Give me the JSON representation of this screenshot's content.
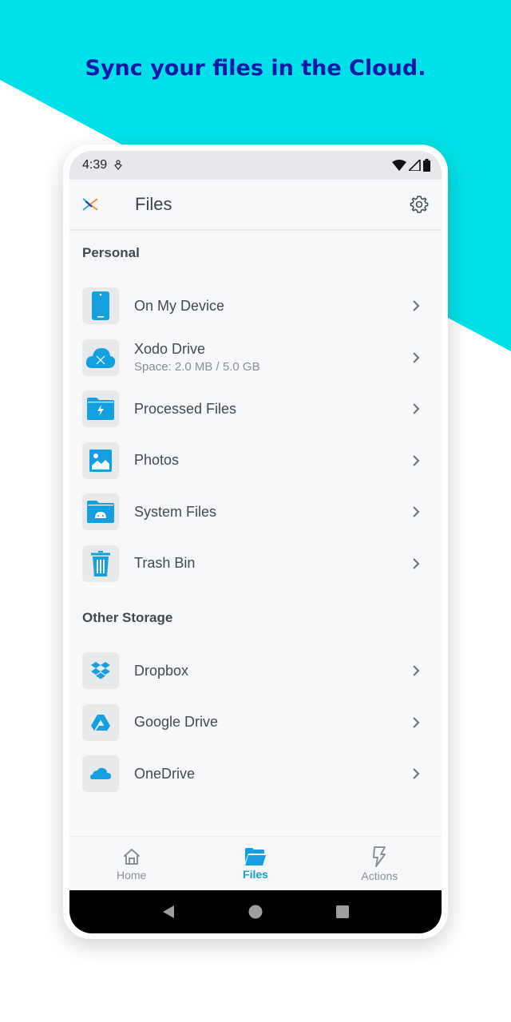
{
  "headline": "Sync your files in the Cloud.",
  "colors": {
    "background_accent": "#00e0e8",
    "headline": "#0b1aa6",
    "icon_blue": "#14a0e0",
    "active_nav": "#14a0e0"
  },
  "status_bar": {
    "time": "4:39",
    "icons": [
      "notification-icon",
      "wifi-icon",
      "signal-icon",
      "battery-icon"
    ]
  },
  "app_bar": {
    "title": "Files",
    "logo": "xodo-logo-icon",
    "action": "gear-icon"
  },
  "sections": [
    {
      "title": "Personal",
      "items": [
        {
          "label": "On My Device",
          "sub": null,
          "icon": "phone-icon"
        },
        {
          "label": "Xodo Drive",
          "sub": "Space: 2.0 MB / 5.0 GB",
          "icon": "cloud-icon"
        },
        {
          "label": "Processed Files",
          "sub": null,
          "icon": "folder-bolt-icon"
        },
        {
          "label": "Photos",
          "sub": null,
          "icon": "image-icon"
        },
        {
          "label": "System Files",
          "sub": null,
          "icon": "folder-android-icon"
        },
        {
          "label": "Trash Bin",
          "sub": null,
          "icon": "trash-icon"
        }
      ]
    },
    {
      "title": "Other Storage",
      "items": [
        {
          "label": "Dropbox",
          "sub": null,
          "icon": "dropbox-icon"
        },
        {
          "label": "Google Drive",
          "sub": null,
          "icon": "google-drive-icon"
        },
        {
          "label": "OneDrive",
          "sub": null,
          "icon": "onedrive-icon"
        }
      ]
    }
  ],
  "bottom_nav": [
    {
      "label": "Home",
      "icon": "home-icon",
      "active": false
    },
    {
      "label": "Files",
      "icon": "folder-open-icon",
      "active": true
    },
    {
      "label": "Actions",
      "icon": "bolt-icon",
      "active": false
    }
  ],
  "system_nav": [
    "back-icon",
    "home-circle-icon",
    "recents-icon"
  ]
}
